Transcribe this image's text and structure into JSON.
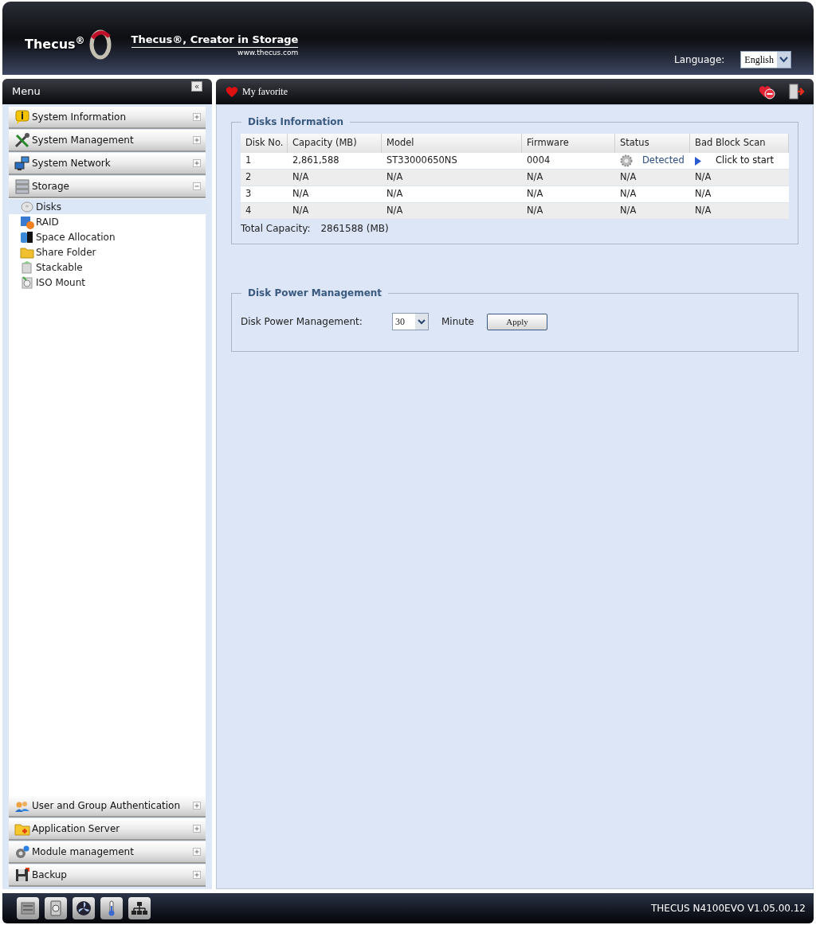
{
  "header": {
    "logo": "Thecus",
    "logo_mark": "®",
    "slogan": "Thecus®, Creator in Storage",
    "website": "www.thecus.com",
    "language_label": "Language:",
    "language": "English"
  },
  "menu": {
    "title": "Menu",
    "collapse": "«"
  },
  "favorite_bar": {
    "title": "My favorite"
  },
  "sidebar": {
    "top_groups": [
      {
        "label": "System Information",
        "expanded": false
      },
      {
        "label": "System Management",
        "expanded": false
      },
      {
        "label": "System Network",
        "expanded": false
      },
      {
        "label": "Storage",
        "expanded": true,
        "children": [
          {
            "label": "Disks",
            "selected": true
          },
          {
            "label": "RAID",
            "selected": false
          },
          {
            "label": "Space Allocation",
            "selected": false
          },
          {
            "label": "Share Folder",
            "selected": false
          },
          {
            "label": "Stackable",
            "selected": false
          },
          {
            "label": "ISO Mount",
            "selected": false
          }
        ]
      }
    ],
    "bottom_groups": [
      {
        "label": "User and Group Authentication",
        "expanded": false
      },
      {
        "label": "Application Server",
        "expanded": false
      },
      {
        "label": "Module management",
        "expanded": false
      },
      {
        "label": "Backup",
        "expanded": false
      }
    ]
  },
  "disks_information": {
    "legend": "Disks Information",
    "columns": [
      "Disk No.",
      "Capacity (MB)",
      "Model",
      "Firmware",
      "Status",
      "Bad Block Scan"
    ],
    "rows": [
      [
        {
          "kind": "text",
          "text": "1"
        },
        {
          "kind": "text",
          "text": "2,861,588"
        },
        {
          "kind": "text",
          "text": "ST33000650NS"
        },
        {
          "kind": "text",
          "text": "0004"
        },
        {
          "kind": "status",
          "text": "Detected"
        },
        {
          "kind": "action",
          "text": "Click to start"
        }
      ],
      [
        {
          "kind": "text",
          "text": "2"
        },
        {
          "kind": "text",
          "text": "N/A"
        },
        {
          "kind": "text",
          "text": "N/A"
        },
        {
          "kind": "text",
          "text": "N/A"
        },
        {
          "kind": "text",
          "text": "N/A"
        },
        {
          "kind": "text",
          "text": "N/A"
        }
      ],
      [
        {
          "kind": "text",
          "text": "3"
        },
        {
          "kind": "text",
          "text": "N/A"
        },
        {
          "kind": "text",
          "text": "N/A"
        },
        {
          "kind": "text",
          "text": "N/A"
        },
        {
          "kind": "text",
          "text": "N/A"
        },
        {
          "kind": "text",
          "text": "N/A"
        }
      ],
      [
        {
          "kind": "text",
          "text": "4"
        },
        {
          "kind": "text",
          "text": "N/A"
        },
        {
          "kind": "text",
          "text": "N/A"
        },
        {
          "kind": "text",
          "text": "N/A"
        },
        {
          "kind": "text",
          "text": "N/A"
        },
        {
          "kind": "text",
          "text": "N/A"
        }
      ]
    ],
    "total_label": "Total Capacity:",
    "total_value": "2861588 (MB)"
  },
  "disk_power_management": {
    "legend": "Disk Power Management",
    "label": "Disk Power Management:",
    "value": "30",
    "unit": "Minute",
    "button": "Apply"
  },
  "status_bar": {
    "version": "THECUS N4100EVO V1.05.00.12"
  }
}
